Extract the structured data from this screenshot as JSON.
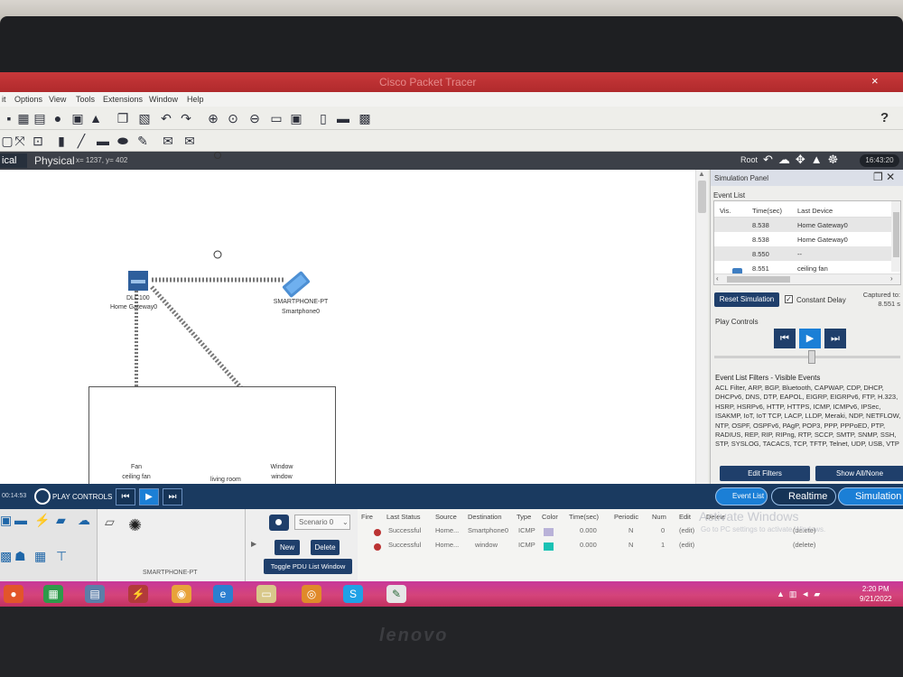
{
  "app": {
    "title": "Cisco Packet Tracer"
  },
  "menu": [
    "File",
    "Options",
    "View",
    "Tools",
    "Extensions",
    "Window",
    "Help"
  ],
  "menu_visible": [
    "it",
    "Options",
    "View",
    "Tools",
    "Extensions",
    "Window",
    "Help"
  ],
  "toolbar": {
    "help_label": "?"
  },
  "workspace": {
    "left_tab": "ical",
    "tab": "Physical",
    "coords": "x= 1237, y= 402",
    "root": "Root",
    "time": "16:43:20"
  },
  "canvas": {
    "gateway_model": "DLC100",
    "gateway_name": "Home Gateway0",
    "smartphone_model": "SMARTPHONE-PT",
    "smartphone_name": "Smartphone0",
    "fan_type": "Fan",
    "fan_name": "ceiling fan",
    "window_type": "Window",
    "window_name": "window",
    "room_label": "living room"
  },
  "sim_panel": {
    "title": "Simulation Panel",
    "event_list_label": "Event List",
    "columns": [
      "Vis.",
      "Time(sec)",
      "Last Device"
    ],
    "rows": [
      {
        "time": "8.538",
        "device": "Home Gateway0",
        "vis": false
      },
      {
        "time": "8.538",
        "device": "Home Gateway0",
        "vis": false
      },
      {
        "time": "8.550",
        "device": "--",
        "vis": false
      },
      {
        "time": "8.551",
        "device": "ceiling fan",
        "vis": true
      }
    ],
    "reset_label": "Reset Simulation",
    "constant_delay_label": "Constant Delay",
    "constant_delay_checked": true,
    "captured_label": "Captured to:",
    "captured_value": "8.551 s",
    "play_controls_label": "Play Controls",
    "filters_title": "Event List Filters - Visible Events",
    "filters_text": "ACL Filter, ARP, BGP, Bluetooth, CAPWAP, CDP, DHCP, DHCPv6, DNS, DTP, EAPOL, EIGRP, EIGRPv6, FTP, H.323, HSRP, HSRPv6, HTTP, HTTPS, ICMP, ICMPv6, IPSec, ISAKMP, IoT, IoT TCP, LACP, LLDP, Meraki, NDP, NETFLOW, NTP, OSPF, OSPFv6, PAgP, POP3, PPP, PPPoED, PTP, RADIUS, REP, RIP, RIPng, RTP, SCCP, SMTP, SNMP, SSH, STP, SYSLOG, TACACS, TCP, TFTP, Telnet, UDP, USB, VTP",
    "edit_filters_label": "Edit Filters",
    "show_all_label": "Show All/None"
  },
  "bottom_bar": {
    "time": "00:14:53",
    "play_controls_label": "PLAY CONTROLS",
    "event_list_label": "Event List",
    "realtime_label": "Realtime",
    "simulation_label": "Simulation"
  },
  "device_area": {
    "selected_label": "SMARTPHONE-PT"
  },
  "scenario": {
    "select_value": "Scenario 0",
    "new_label": "New",
    "delete_label": "Delete",
    "toggle_label": "Toggle PDU List Window"
  },
  "pdu_list": {
    "columns": [
      "Fire",
      "Last Status",
      "Source",
      "Destination",
      "Type",
      "Color",
      "Time(sec)",
      "Periodic",
      "Num",
      "Edit",
      "Delete"
    ],
    "rows": [
      {
        "status": "Successful",
        "source": "Home...",
        "destination": "Smartphone0",
        "type": "ICMP",
        "color": "#b9b2d8",
        "time": "0.000",
        "periodic": "N",
        "num": "0",
        "edit": "(edit)",
        "delete": "(delete)"
      },
      {
        "status": "Successful",
        "source": "Home...",
        "destination": "window",
        "type": "ICMP",
        "color": "#19c2b4",
        "time": "0.000",
        "periodic": "N",
        "num": "1",
        "edit": "(edit)",
        "delete": "(delete)"
      }
    ],
    "watermark_title": "Activate Windows",
    "watermark_sub": "Go to PC settings to activate Windows."
  },
  "taskbar": {
    "time": "2:20 PM",
    "date": "9/21/2022"
  },
  "device_brand": "lenovo"
}
